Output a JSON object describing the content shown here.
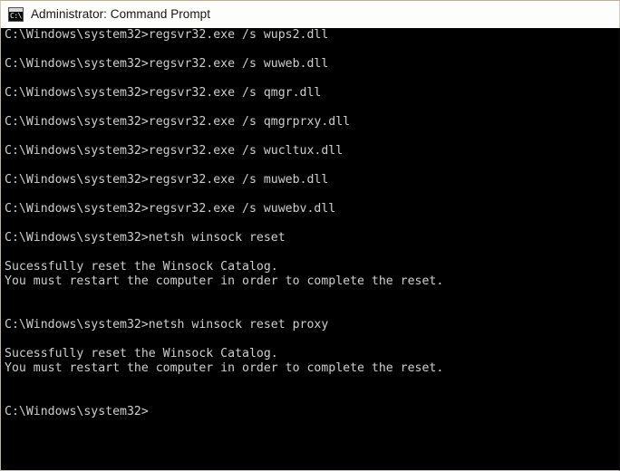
{
  "window": {
    "title": "Administrator: Command Prompt",
    "icon": "console-icon",
    "icon_glyph": "C:\\.",
    "background_color": "#000000",
    "titlebar_color": "#fdfdfb",
    "text_color": "#cfcfcf",
    "title_text_color": "#16160f"
  },
  "console": {
    "prompt": "C:\\Windows\\system32>",
    "lines": [
      {
        "type": "command",
        "text": "C:\\Windows\\system32>regsvr32.exe /s wups2.dll"
      },
      {
        "type": "blank",
        "text": ""
      },
      {
        "type": "command",
        "text": "C:\\Windows\\system32>regsvr32.exe /s wuweb.dll"
      },
      {
        "type": "blank",
        "text": ""
      },
      {
        "type": "command",
        "text": "C:\\Windows\\system32>regsvr32.exe /s qmgr.dll"
      },
      {
        "type": "blank",
        "text": ""
      },
      {
        "type": "command",
        "text": "C:\\Windows\\system32>regsvr32.exe /s qmgrprxy.dll"
      },
      {
        "type": "blank",
        "text": ""
      },
      {
        "type": "command",
        "text": "C:\\Windows\\system32>regsvr32.exe /s wucltux.dll"
      },
      {
        "type": "blank",
        "text": ""
      },
      {
        "type": "command",
        "text": "C:\\Windows\\system32>regsvr32.exe /s muweb.dll"
      },
      {
        "type": "blank",
        "text": ""
      },
      {
        "type": "command",
        "text": "C:\\Windows\\system32>regsvr32.exe /s wuwebv.dll"
      },
      {
        "type": "blank",
        "text": ""
      },
      {
        "type": "command",
        "text": "C:\\Windows\\system32>netsh winsock reset"
      },
      {
        "type": "blank",
        "text": ""
      },
      {
        "type": "output",
        "text": "Sucessfully reset the Winsock Catalog."
      },
      {
        "type": "output",
        "text": "You must restart the computer in order to complete the reset."
      },
      {
        "type": "blank",
        "text": ""
      },
      {
        "type": "blank",
        "text": ""
      },
      {
        "type": "command",
        "text": "C:\\Windows\\system32>netsh winsock reset proxy"
      },
      {
        "type": "blank",
        "text": ""
      },
      {
        "type": "output",
        "text": "Sucessfully reset the Winsock Catalog."
      },
      {
        "type": "output",
        "text": "You must restart the computer in order to complete the reset."
      },
      {
        "type": "blank",
        "text": ""
      },
      {
        "type": "blank",
        "text": ""
      },
      {
        "type": "command",
        "text": "C:\\Windows\\system32>"
      }
    ]
  }
}
